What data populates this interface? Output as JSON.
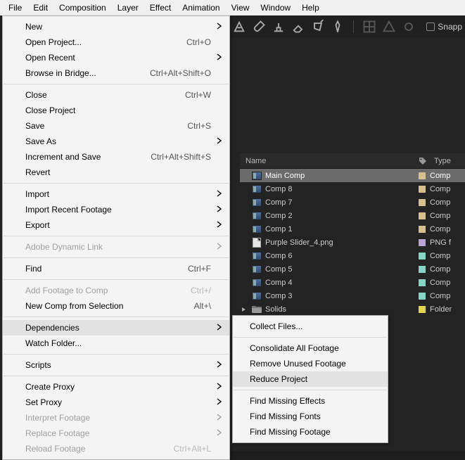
{
  "menubar": [
    "File",
    "Edit",
    "Composition",
    "Layer",
    "Effect",
    "Animation",
    "View",
    "Window",
    "Help"
  ],
  "toolbar": {
    "snapping_label": "Snapp"
  },
  "file_menu": {
    "groups": [
      [
        {
          "label": "New",
          "shortcut": "",
          "sub": true
        },
        {
          "label": "Open Project...",
          "shortcut": "Ctrl+O"
        },
        {
          "label": "Open Recent",
          "shortcut": "",
          "sub": true
        },
        {
          "label": "Browse in Bridge...",
          "shortcut": "Ctrl+Alt+Shift+O"
        }
      ],
      [
        {
          "label": "Close",
          "shortcut": "Ctrl+W"
        },
        {
          "label": "Close Project",
          "shortcut": ""
        },
        {
          "label": "Save",
          "shortcut": "Ctrl+S"
        },
        {
          "label": "Save As",
          "shortcut": "",
          "sub": true
        },
        {
          "label": "Increment and Save",
          "shortcut": "Ctrl+Alt+Shift+S"
        },
        {
          "label": "Revert",
          "shortcut": ""
        }
      ],
      [
        {
          "label": "Import",
          "shortcut": "",
          "sub": true
        },
        {
          "label": "Import Recent Footage",
          "shortcut": "",
          "sub": true
        },
        {
          "label": "Export",
          "shortcut": "",
          "sub": true
        }
      ],
      [
        {
          "label": "Adobe Dynamic Link",
          "shortcut": "",
          "sub": true,
          "disabled": true
        }
      ],
      [
        {
          "label": "Find",
          "shortcut": "Ctrl+F"
        }
      ],
      [
        {
          "label": "Add Footage to Comp",
          "shortcut": "Ctrl+/",
          "disabled": true
        },
        {
          "label": "New Comp from Selection",
          "shortcut": "Alt+\\"
        }
      ],
      [
        {
          "label": "Dependencies",
          "shortcut": "",
          "sub": true,
          "hl": true
        },
        {
          "label": "Watch Folder...",
          "shortcut": ""
        }
      ],
      [
        {
          "label": "Scripts",
          "shortcut": "",
          "sub": true
        }
      ],
      [
        {
          "label": "Create Proxy",
          "shortcut": "",
          "sub": true
        },
        {
          "label": "Set Proxy",
          "shortcut": "",
          "sub": true
        },
        {
          "label": "Interpret Footage",
          "shortcut": "",
          "sub": true,
          "disabled": true
        },
        {
          "label": "Replace Footage",
          "shortcut": "",
          "sub": true,
          "disabled": true
        },
        {
          "label": "Reload Footage",
          "shortcut": "Ctrl+Alt+L",
          "disabled": true
        }
      ]
    ]
  },
  "submenu": [
    {
      "label": "Collect Files..."
    },
    {
      "sep": true
    },
    {
      "label": "Consolidate All Footage"
    },
    {
      "label": "Remove Unused Footage"
    },
    {
      "label": "Reduce Project",
      "hl": true
    },
    {
      "sep": true
    },
    {
      "label": "Find Missing Effects"
    },
    {
      "label": "Find Missing Fonts"
    },
    {
      "label": "Find Missing Footage"
    }
  ],
  "project": {
    "headers": {
      "name": "Name",
      "type": "Type"
    },
    "rows": [
      {
        "name": "Main Comp",
        "type": "Comp",
        "kind": "comp",
        "sw": "#d6c08f",
        "sel": true
      },
      {
        "name": "Comp 8",
        "type": "Comp",
        "kind": "comp",
        "sw": "#d6c08f"
      },
      {
        "name": "Comp 7",
        "type": "Comp",
        "kind": "comp",
        "sw": "#d6c08f"
      },
      {
        "name": "Comp 2",
        "type": "Comp",
        "kind": "comp",
        "sw": "#d6c08f"
      },
      {
        "name": "Comp 1",
        "type": "Comp",
        "kind": "comp",
        "sw": "#d6c08f"
      },
      {
        "name": "Purple Slider_4.png",
        "type": "PNG f",
        "kind": "png",
        "sw": "#b9a5d6"
      },
      {
        "name": "Comp 6",
        "type": "Comp",
        "kind": "comp",
        "sw": "#87d3c5"
      },
      {
        "name": "Comp 5",
        "type": "Comp",
        "kind": "comp",
        "sw": "#87d3c5"
      },
      {
        "name": "Comp 4",
        "type": "Comp",
        "kind": "comp",
        "sw": "#87d3c5"
      },
      {
        "name": "Comp 3",
        "type": "Comp",
        "kind": "comp",
        "sw": "#87d3c5"
      },
      {
        "name": "Solids",
        "type": "Folder",
        "kind": "folder",
        "sw": "#e6d64d"
      }
    ]
  }
}
